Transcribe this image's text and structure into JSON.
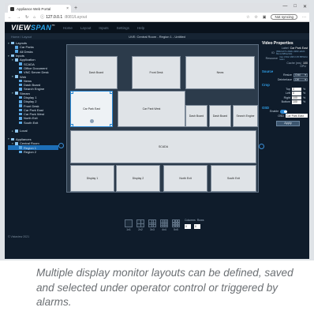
{
  "browser": {
    "tab_title": "Appliance Web Portal",
    "tab_close": "×",
    "new_tab": "+",
    "window_controls": [
      "—",
      "□",
      "✕"
    ],
    "url_host": "127.0.0.1",
    "url_path": ":8081/Layout",
    "sync_label": "Not syncing"
  },
  "app": {
    "logo_view": "VIEW",
    "logo_span": "SPAN",
    "logo_tm": "™",
    "nav": [
      "Home",
      "Layout",
      "Inputs",
      "Settings",
      "Help"
    ],
    "breadcrumb": "Home / Layout",
    "title": "UVE: Central Room - Region 1 - Untitled",
    "copyright": "© Vistaview 2021"
  },
  "tree": [
    {
      "label": "Layouts",
      "depth": 0,
      "arrow": "▾",
      "icon": "folder"
    },
    {
      "label": "Car Parks",
      "depth": 1,
      "arrow": "",
      "icon": "item"
    },
    {
      "label": "All Desks",
      "depth": 1,
      "arrow": "",
      "icon": "item"
    },
    {
      "label": "Inputs",
      "depth": 0,
      "arrow": "▾",
      "icon": "folder"
    },
    {
      "label": "Application",
      "depth": 1,
      "arrow": "▾",
      "icon": "folder"
    },
    {
      "label": "SCADA",
      "depth": 2,
      "arrow": "",
      "icon": "item"
    },
    {
      "label": "Office Document",
      "depth": 2,
      "arrow": "",
      "icon": "item"
    },
    {
      "label": "VNC Server Desk",
      "depth": 2,
      "arrow": "",
      "icon": "item"
    },
    {
      "label": "Web",
      "depth": 1,
      "arrow": "▾",
      "icon": "folder"
    },
    {
      "label": "News",
      "depth": 2,
      "arrow": "",
      "icon": "item"
    },
    {
      "label": "Dash Board",
      "depth": 2,
      "arrow": "",
      "icon": "item"
    },
    {
      "label": "Search Engine",
      "depth": 2,
      "arrow": "",
      "icon": "item"
    },
    {
      "label": "Stream",
      "depth": 1,
      "arrow": "▾",
      "icon": "folder"
    },
    {
      "label": "Display 1",
      "depth": 2,
      "arrow": "",
      "icon": "item"
    },
    {
      "label": "Display 2",
      "depth": 2,
      "arrow": "",
      "icon": "item"
    },
    {
      "label": "Front Desk",
      "depth": 2,
      "arrow": "",
      "icon": "item"
    },
    {
      "label": "Car Park East",
      "depth": 2,
      "arrow": "",
      "icon": "item"
    },
    {
      "label": "Car Park West",
      "depth": 2,
      "arrow": "",
      "icon": "item"
    },
    {
      "label": "North Exit",
      "depth": 2,
      "arrow": "",
      "icon": "item"
    },
    {
      "label": "South Exit",
      "depth": 2,
      "arrow": "",
      "icon": "item"
    },
    {
      "label": "",
      "depth": 0,
      "arrow": "",
      "icon": "none"
    },
    {
      "label": "Local",
      "depth": 1,
      "arrow": "▸",
      "icon": "folder"
    },
    {
      "label": "",
      "depth": 0,
      "arrow": "",
      "icon": "none"
    },
    {
      "label": "Appliances",
      "depth": 0,
      "arrow": "▾",
      "icon": "folder"
    },
    {
      "label": "Central Room",
      "depth": 1,
      "arrow": "▾",
      "icon": "folder"
    },
    {
      "label": "Region 1",
      "depth": 2,
      "arrow": "",
      "icon": "item",
      "selected": true
    },
    {
      "label": "Region 2",
      "depth": 2,
      "arrow": "",
      "icon": "item"
    }
  ],
  "monitors": [
    {
      "label": "Dash Board",
      "highlight": false
    },
    {
      "label": "Front Desk",
      "highlight": false
    },
    {
      "label": "News",
      "highlight": false
    },
    {
      "label": "Car Park East",
      "highlight": true
    },
    {
      "label": "Car Park West",
      "highlight": false
    },
    {
      "label": "Dash Board",
      "highlight": false
    },
    {
      "label": "Dash Board",
      "highlight": false
    },
    {
      "label": "Search Engine",
      "highlight": false
    },
    {
      "label": "SCADA",
      "highlight": false
    },
    {
      "label": "Display 1",
      "highlight": false
    },
    {
      "label": "Display 2",
      "highlight": false
    },
    {
      "label": "North Exit",
      "highlight": false
    },
    {
      "label": "South Exit",
      "highlight": false
    }
  ],
  "layout_presets": [
    "1x1",
    "2x2",
    "3x3",
    "4x4",
    "5x5"
  ],
  "grid_controls": {
    "columns_label": "Columns",
    "rows_label": "Rows",
    "columns": "0",
    "rows": "0"
  },
  "properties": {
    "heading": "Video Properties",
    "label_key": "Label",
    "label_value": "Car Park East",
    "id_key": "ID",
    "id_value": "{8fd2c271-29db-4382-a6c6-6bcccb86ecbd}",
    "resource_key": "Resource",
    "resource_value": "rtsp://192.168.0.35:8554/stream",
    "cache_key": "Cache (ms)",
    "cache_value": "100",
    "gpu_key": "GPU",
    "gpu_value": "",
    "source_heading": "Source",
    "resize_label": "Resize",
    "resize_value": "Grid",
    "deinterlace_label": "Deinterlace",
    "deinterlace_value": "Off",
    "crop_heading": "Crop",
    "crop": [
      {
        "label": "Top",
        "value": "0",
        "unit": "%"
      },
      {
        "label": "Left",
        "value": "0",
        "unit": "%"
      },
      {
        "label": "Right",
        "value": "100",
        "unit": "%"
      },
      {
        "label": "Bottom",
        "value": "100",
        "unit": "%"
      }
    ],
    "osd_heading": "OSD",
    "enable_label": "Enable",
    "enable_on": true,
    "osd_label": "OSD",
    "osd_value": "Car Park East",
    "apply_label": "Apply"
  },
  "caption": "Multiple display monitor layouts can be defined, saved and selected under operator control or triggered by alarms.",
  "colors": {
    "accent": "#2c8ad6",
    "app_bg": "#0f1c2b",
    "monitor": "#dfe3e7"
  }
}
